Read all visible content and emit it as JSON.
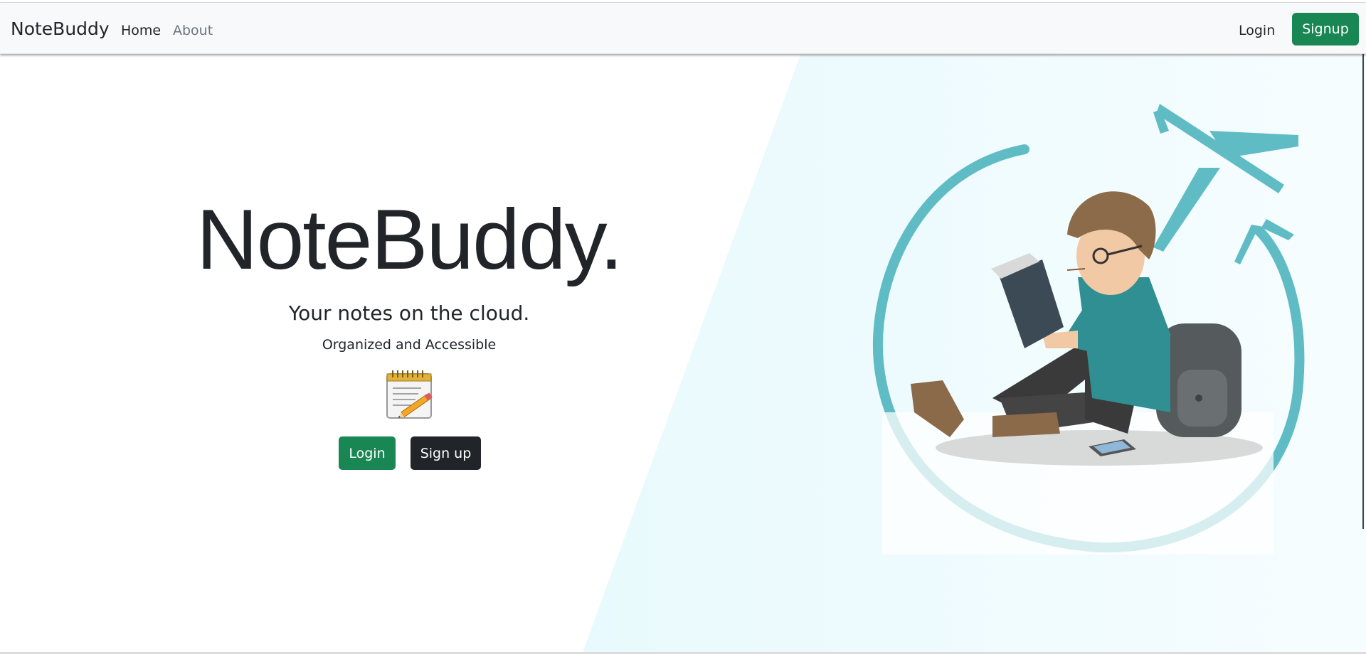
{
  "navbar": {
    "brand": "NoteBuddy",
    "links": [
      {
        "label": "Home",
        "active": true
      },
      {
        "label": "About",
        "active": false
      }
    ],
    "login_label": "Login",
    "signup_label": "Signup"
  },
  "hero": {
    "title": "NoteBuddy.",
    "subtitle": "Your notes on the cloud.",
    "tagline": "Organized and Accessible",
    "icon": "notepad-pencil-icon",
    "login_button": "Login",
    "signup_button": "Sign up"
  },
  "illustration": {
    "icon": "student-reading-airplane-illustration"
  },
  "colors": {
    "primary_green": "#198754",
    "dark": "#212529",
    "navbar_bg": "#f8f9fa",
    "panel_tint": "#dcf6fb",
    "teal": "#5fbcc4"
  }
}
